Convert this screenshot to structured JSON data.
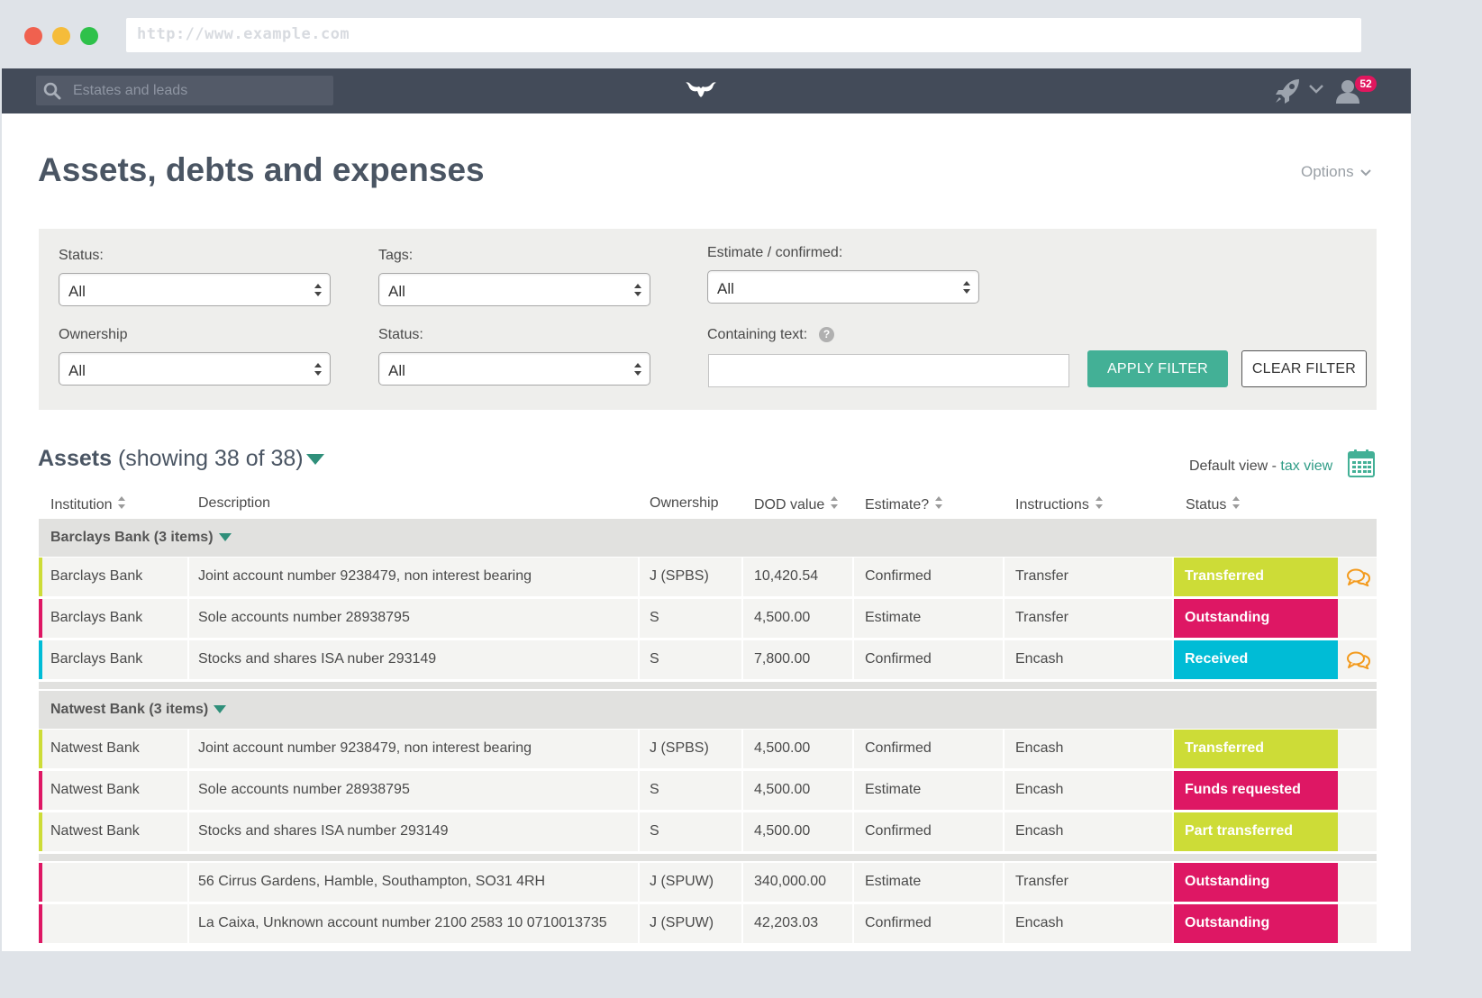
{
  "browser": {
    "url": "http://www.example.com"
  },
  "nav": {
    "search_placeholder": "Estates and leads",
    "notification_count": "52"
  },
  "page": {
    "title": "Assets, debts and expenses",
    "options_label": "Options"
  },
  "filters": {
    "status_label": "Status:",
    "status_value": "All",
    "tags_label": "Tags:",
    "tags_value": "All",
    "estimate_label": "Estimate / confirmed:",
    "estimate_value": "All",
    "ownership_label": "Ownership",
    "ownership_value": "All",
    "status2_label": "Status:",
    "status2_value": "All",
    "text_label": "Containing text:",
    "text_value": "",
    "help_glyph": "?",
    "apply_label": "APPLY FILTER",
    "clear_label": "CLEAR FILTER"
  },
  "assets": {
    "title": "Assets",
    "showing": "(showing 38 of 38)",
    "default_view": "Default view -",
    "tax_view": "tax view"
  },
  "columns": [
    "Institution",
    "Description",
    "Ownership",
    "DOD value",
    "Estimate?",
    "Instructions",
    "Status"
  ],
  "colors": {
    "Transferred": "#cddc37",
    "Outstanding": "#de1764",
    "Received": "#00bcd6",
    "Funds requested": "#de1764",
    "Part transferred": "#cddc37",
    "accent": "#43b096",
    "nav": "#434b59"
  },
  "groups": [
    {
      "label": "Barclays Bank (3 items)",
      "rows": [
        {
          "institution": "Barclays Bank",
          "description": "Joint account number 9238479, non interest bearing",
          "ownership": "J (SPBS)",
          "value": "10,420.54",
          "estimate": "Confirmed",
          "instructions": "Transfer",
          "status": "Transferred",
          "comment": true
        },
        {
          "institution": "Barclays Bank",
          "description": "Sole accounts number 28938795",
          "ownership": "S",
          "value": "4,500.00",
          "estimate": "Estimate",
          "instructions": "Transfer",
          "status": "Outstanding",
          "comment": false
        },
        {
          "institution": "Barclays Bank",
          "description": "Stocks and shares ISA nuber 293149",
          "ownership": "S",
          "value": "7,800.00",
          "estimate": "Confirmed",
          "instructions": "Encash",
          "status": "Received",
          "comment": true
        }
      ]
    },
    {
      "label": "Natwest Bank (3 items)",
      "rows": [
        {
          "institution": "Natwest Bank",
          "description": "Joint account number 9238479, non interest bearing",
          "ownership": "J (SPBS)",
          "value": "4,500.00",
          "estimate": "Confirmed",
          "instructions": "Encash",
          "status": "Transferred",
          "comment": false
        },
        {
          "institution": "Natwest Bank",
          "description": "Sole accounts number 28938795",
          "ownership": "S",
          "value": "4,500.00",
          "estimate": "Estimate",
          "instructions": "Encash",
          "status": "Funds requested",
          "comment": false
        },
        {
          "institution": "Natwest Bank",
          "description": "Stocks and shares ISA number 293149",
          "ownership": "S",
          "value": "4,500.00",
          "estimate": "Confirmed",
          "instructions": "Encash",
          "status": "Part transferred",
          "comment": false
        }
      ]
    },
    {
      "label": "",
      "rows": [
        {
          "institution": "",
          "description": "56 Cirrus Gardens, Hamble, Southampton, SO31 4RH",
          "ownership": "J (SPUW)",
          "value": "340,000.00",
          "estimate": "Estimate",
          "instructions": "Transfer",
          "status": "Outstanding",
          "comment": false
        },
        {
          "institution": "",
          "description": "La Caixa, Unknown account number 2100 2583 10 0710013735",
          "ownership": "J (SPUW)",
          "value": "42,203.03",
          "estimate": "Confirmed",
          "instructions": "Encash",
          "status": "Outstanding",
          "comment": false
        }
      ]
    }
  ]
}
